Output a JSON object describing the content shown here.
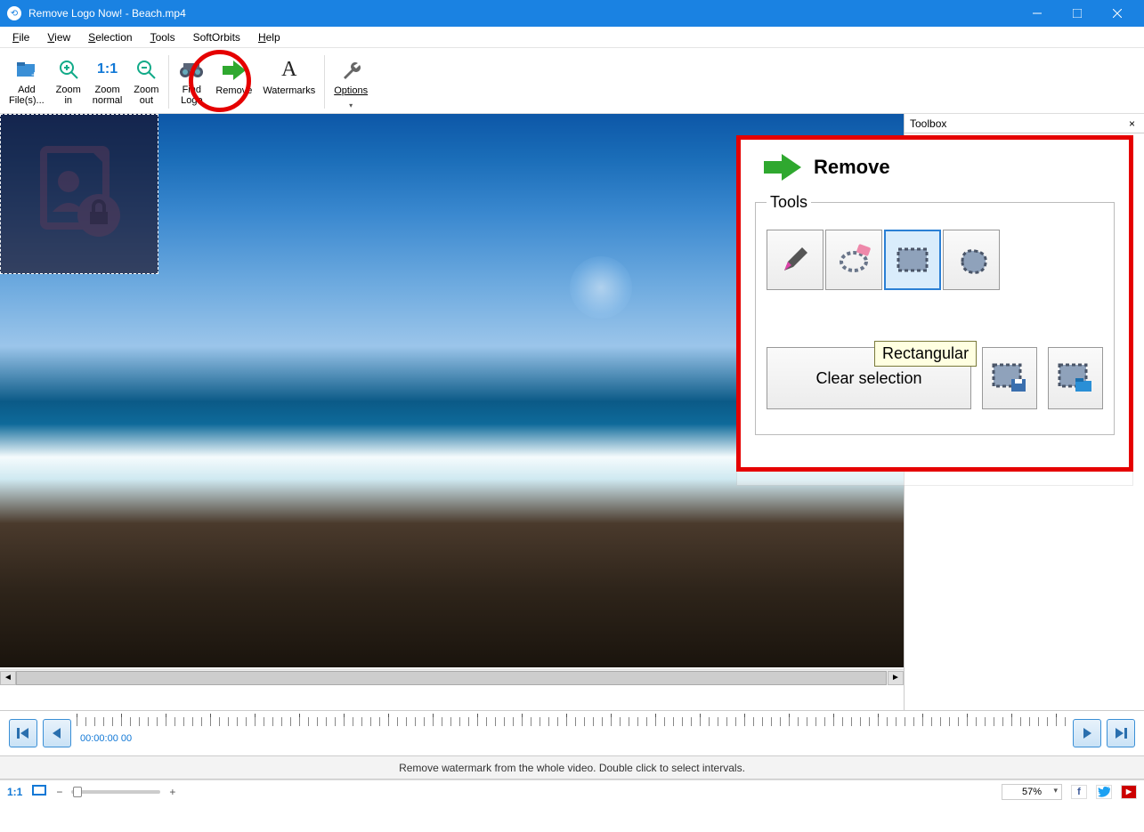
{
  "window": {
    "title": "Remove Logo Now! - Beach.mp4"
  },
  "menu": {
    "file": "File",
    "view": "View",
    "selection": "Selection",
    "tools": "Tools",
    "softorbits": "SoftOrbits",
    "help": "Help"
  },
  "toolbar": {
    "add_files": "Add\nFile(s)...",
    "zoom_in": "Zoom\nin",
    "zoom_normal": "Zoom\nnormal",
    "zoom_out": "Zoom\nout",
    "find_logo": "Find\nLogo",
    "remove": "Remove",
    "watermarks": "Watermarks",
    "options": "Options"
  },
  "toolbox": {
    "title": "Toolbox",
    "panel_title": "Remove",
    "tools_legend": "Tools",
    "tooltip": "Rectangular",
    "clear_selection": "Clear selection"
  },
  "timeline": {
    "timecode": "00:00:00 00"
  },
  "infobar": {
    "text": "Remove watermark from the whole video. Double click to select intervals."
  },
  "statusbar": {
    "ratio_label": "1:1",
    "zoom_percent": "57%"
  }
}
